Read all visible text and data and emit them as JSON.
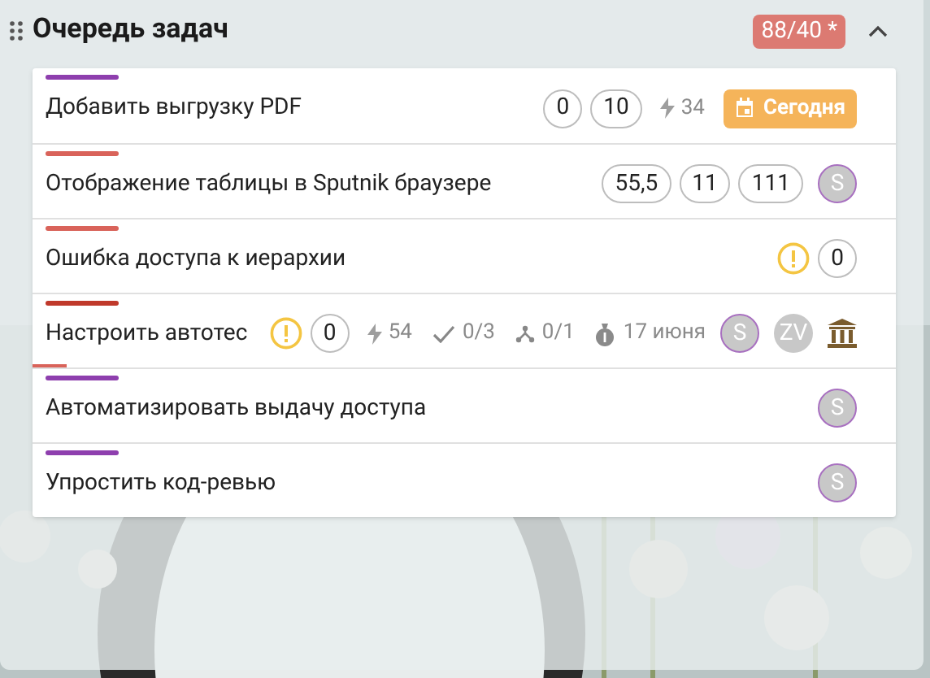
{
  "panel": {
    "title": "Очередь задач",
    "counter": "88/40 *",
    "expanded": true
  },
  "tasks": [
    {
      "title": "Добавить выгрузку PDF",
      "color": "#8e3fae",
      "items": [
        {
          "kind": "pill",
          "text": "0"
        },
        {
          "kind": "pill",
          "text": "10"
        },
        {
          "kind": "effort",
          "text": "34"
        },
        {
          "kind": "due_today",
          "text": "Сегодня"
        }
      ]
    },
    {
      "title": "Отображение таблицы в Sputnik браузере",
      "color": "#d9635a",
      "items": [
        {
          "kind": "pill",
          "text": "55,5"
        },
        {
          "kind": "pill",
          "text": "11"
        },
        {
          "kind": "pill",
          "text": "111"
        },
        {
          "kind": "avatar",
          "text": "S",
          "selected": true
        }
      ]
    },
    {
      "title": "Ошибка доступа к иерархии",
      "color": "#d9635a",
      "items": [
        {
          "kind": "warning"
        },
        {
          "kind": "pill",
          "text": "0"
        }
      ]
    },
    {
      "title": "Настроить автотес",
      "color": "#c0392b",
      "level": 0.04,
      "items": [
        {
          "kind": "warning"
        },
        {
          "kind": "pill",
          "text": "0"
        },
        {
          "kind": "effort",
          "text": "54"
        },
        {
          "kind": "checks",
          "text": "0/3"
        },
        {
          "kind": "branches",
          "text": "0/1"
        },
        {
          "kind": "deadline",
          "text": "17 июня"
        },
        {
          "kind": "avatar",
          "text": "S",
          "selected": true
        },
        {
          "kind": "avatar",
          "text": "ZV",
          "selected": false
        },
        {
          "kind": "bank"
        }
      ]
    },
    {
      "title": "Автоматизировать выдачу доступа",
      "color": "#8e3fae",
      "items": [
        {
          "kind": "avatar",
          "text": "S",
          "selected": true
        }
      ]
    },
    {
      "title": "Упростить код-ревью",
      "color": "#8e3fae",
      "items": [
        {
          "kind": "avatar",
          "text": "S",
          "selected": true
        }
      ]
    }
  ]
}
